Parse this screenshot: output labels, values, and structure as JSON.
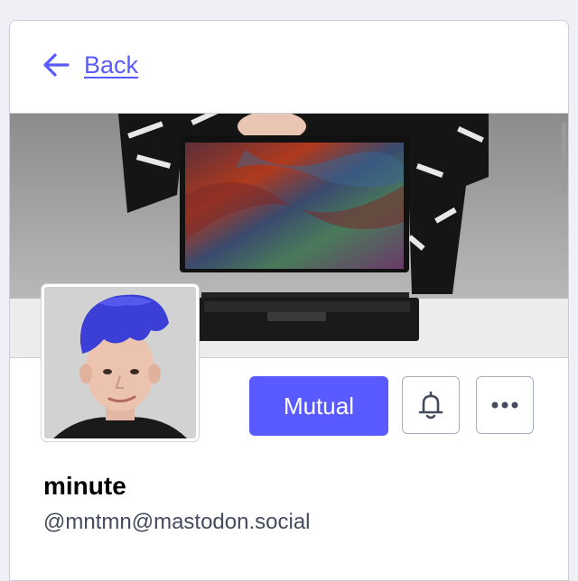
{
  "nav": {
    "back_label": "Back"
  },
  "profile": {
    "display_name": "minute",
    "account": "@mntmn@mastodon.social"
  },
  "actions": {
    "relationship_label": "Mutual",
    "notify_icon": "bell-icon",
    "menu_icon": "ellipsis-icon"
  },
  "colors": {
    "accent": "#595aff",
    "border": "#c9cdd8",
    "text_primary": "#000000",
    "text_secondary": "#444b5d"
  }
}
